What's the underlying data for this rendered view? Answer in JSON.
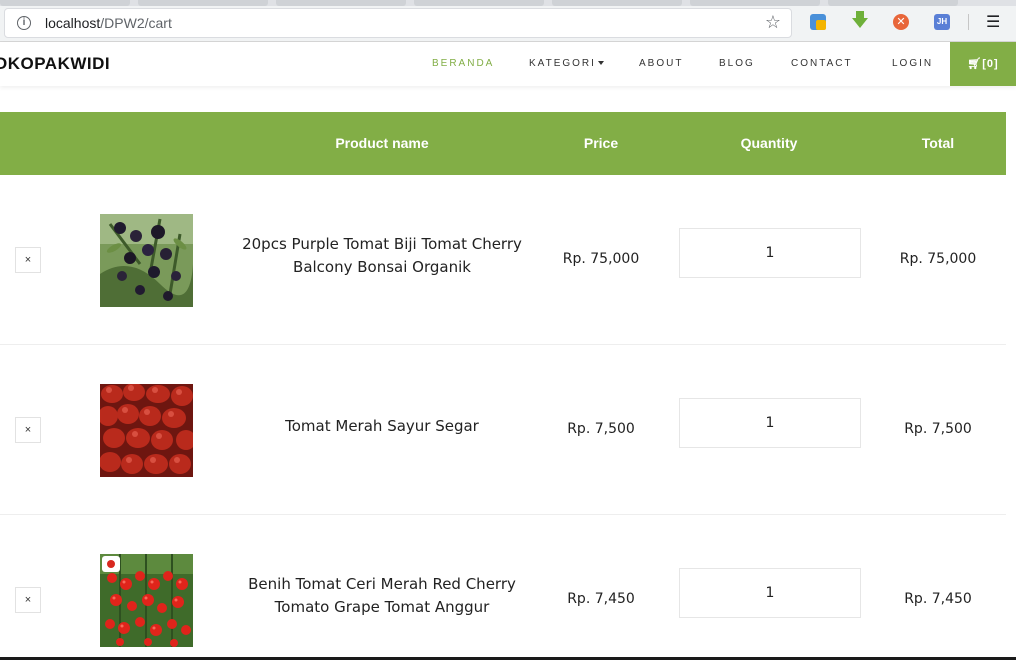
{
  "browser": {
    "url_host": "localhost",
    "url_path": "/DPW2/cart",
    "info_icon": "info-icon",
    "bookmark_icon": "star-icon",
    "extensions": [
      "translate-icon",
      "download-icon",
      "block-icon",
      "jh-icon"
    ],
    "jh_label": "JH",
    "block_label": "⊗"
  },
  "nav": {
    "logo": "OKOPAKWIDI",
    "links": {
      "beranda": "BERANDA",
      "kategori": "KATEGORI",
      "about": "ABOUT",
      "blog": "BLOG",
      "contact": "CONTACT",
      "login": "LOGIN"
    },
    "active_link": "BERANDA",
    "cart_label": "[0]",
    "accent_color": "#82ae46"
  },
  "table": {
    "headers": {
      "product_name": "Product name",
      "price": "Price",
      "quantity": "Quantity",
      "total": "Total"
    },
    "rows": [
      {
        "remove": "×",
        "image": "purple-cherry-tomato-photo",
        "name": "20pcs Purple Tomat Biji Tomat Cherry Balcony Bonsai Organik",
        "price": "Rp. 75,000",
        "quantity": "1",
        "total": "Rp. 75,000"
      },
      {
        "remove": "×",
        "image": "red-tomato-pile-photo",
        "name": "Tomat Merah Sayur Segar",
        "price": "Rp. 7,500",
        "quantity": "1",
        "total": "Rp. 7,500"
      },
      {
        "remove": "×",
        "image": "red-cherry-tomato-vine-photo",
        "name": "Benih Tomat Ceri Merah Red Cherry Tomato Grape Tomat Anggur",
        "price": "Rp. 7,450",
        "quantity": "1",
        "total": "Rp. 7,450"
      }
    ]
  }
}
